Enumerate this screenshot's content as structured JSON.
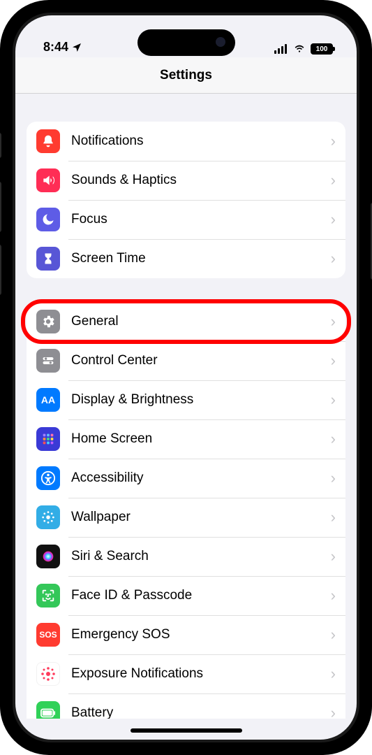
{
  "status": {
    "time": "8:44",
    "battery": "100"
  },
  "header": {
    "title": "Settings"
  },
  "sections": [
    {
      "items": [
        {
          "id": "notifications",
          "label": "Notifications"
        },
        {
          "id": "sounds-haptics",
          "label": "Sounds & Haptics"
        },
        {
          "id": "focus",
          "label": "Focus"
        },
        {
          "id": "screen-time",
          "label": "Screen Time"
        }
      ]
    },
    {
      "items": [
        {
          "id": "general",
          "label": "General",
          "highlighted": true
        },
        {
          "id": "control-center",
          "label": "Control Center"
        },
        {
          "id": "display-brightness",
          "label": "Display & Brightness"
        },
        {
          "id": "home-screen",
          "label": "Home Screen"
        },
        {
          "id": "accessibility",
          "label": "Accessibility"
        },
        {
          "id": "wallpaper",
          "label": "Wallpaper"
        },
        {
          "id": "siri-search",
          "label": "Siri & Search"
        },
        {
          "id": "face-id-passcode",
          "label": "Face ID & Passcode"
        },
        {
          "id": "emergency-sos",
          "label": "Emergency SOS"
        },
        {
          "id": "exposure-notifications",
          "label": "Exposure Notifications"
        },
        {
          "id": "battery",
          "label": "Battery"
        }
      ]
    }
  ]
}
